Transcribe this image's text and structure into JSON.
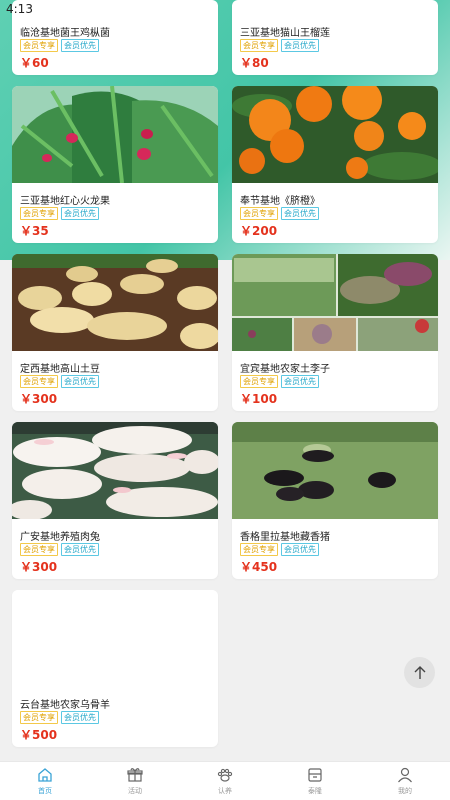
{
  "status": {
    "time": "4:13"
  },
  "tag_labels": {
    "member_only": "会员专享",
    "member_priority": "会员优先"
  },
  "products": [
    {
      "title": "临沧基地菌王鸡枞菌",
      "price": "￥60"
    },
    {
      "title": "三亚基地猫山王榴莲",
      "price": "￥80"
    },
    {
      "title": "三亚基地红心火龙果",
      "price": "￥35"
    },
    {
      "title": "奉节基地《脐橙》",
      "price": "￥200"
    },
    {
      "title": "定西基地高山土豆",
      "price": "￥300"
    },
    {
      "title": "宜宾基地农家土李子",
      "price": "￥100"
    },
    {
      "title": "广安基地养殖肉兔",
      "price": "￥300"
    },
    {
      "title": "香格里拉基地藏香猪",
      "price": "￥450"
    },
    {
      "title": "云台基地农家乌骨羊",
      "price": "￥500"
    }
  ],
  "tabbar": {
    "items": [
      {
        "label": "首页",
        "icon": "home-icon",
        "active": true
      },
      {
        "label": "活动",
        "icon": "gift-icon",
        "active": false
      },
      {
        "label": "认养",
        "icon": "paw-icon",
        "active": false
      },
      {
        "label": "泰隆",
        "icon": "box-icon",
        "active": false
      },
      {
        "label": "我的",
        "icon": "user-icon",
        "active": false
      }
    ]
  },
  "colors": {
    "accent": "#43c5a7",
    "price": "#e4321d",
    "tab_active": "#3aa3d6"
  }
}
